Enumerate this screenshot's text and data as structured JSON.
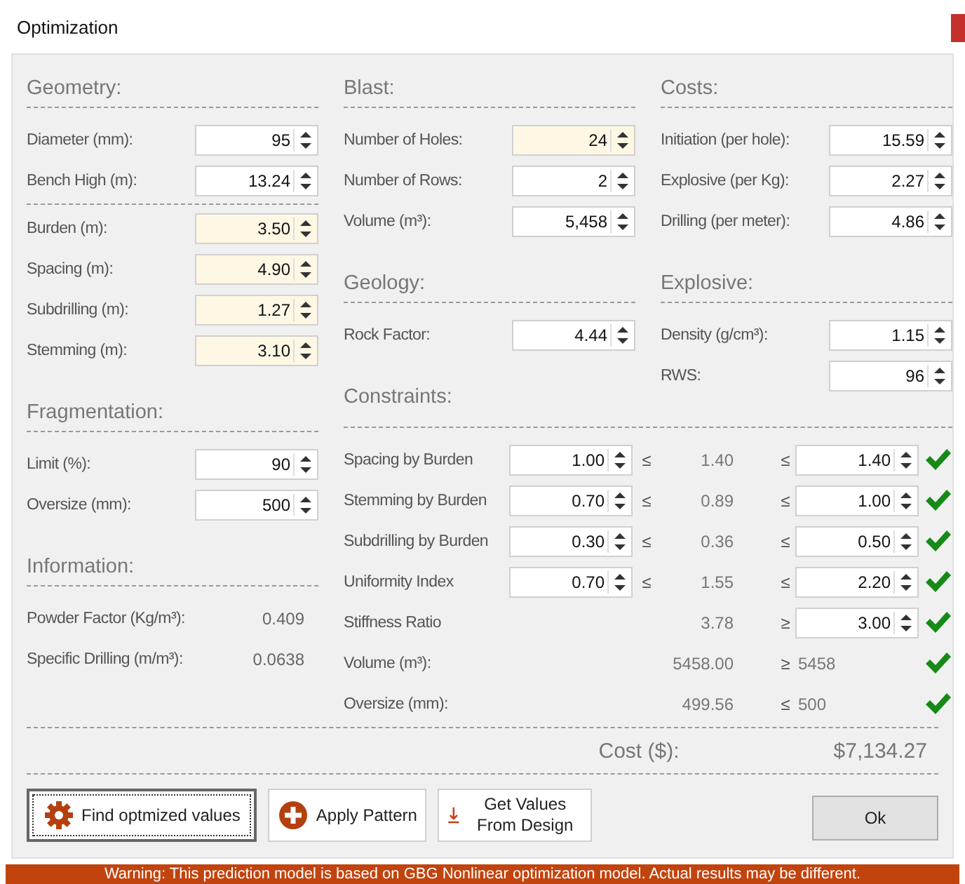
{
  "window": {
    "title": "Optimization"
  },
  "geometry": {
    "title": "Geometry:",
    "groups": [
      [
        {
          "label": "Diameter (mm):",
          "value": "95",
          "highlighted": false
        },
        {
          "label": "Bench High (m):",
          "value": "13.24",
          "highlighted": false
        }
      ],
      [
        {
          "label": "Burden (m):",
          "value": "3.50",
          "highlighted": true
        },
        {
          "label": "Spacing  (m):",
          "value": "4.90",
          "highlighted": true
        },
        {
          "label": "Subdrilling (m):",
          "value": "1.27",
          "highlighted": true
        },
        {
          "label": "Stemming (m):",
          "value": "3.10",
          "highlighted": true
        }
      ]
    ]
  },
  "fragmentation": {
    "title": "Fragmentation:",
    "fields": [
      {
        "label": "Limit (%):",
        "value": "90",
        "highlighted": false
      },
      {
        "label": "Oversize (mm):",
        "value": "500",
        "highlighted": false
      }
    ]
  },
  "information": {
    "title": "Information:",
    "rows": [
      {
        "label": "Powder Factor (Kg/m³):",
        "value": "0.409"
      },
      {
        "label": "Specific Drilling (m/m³):",
        "value": "0.0638"
      }
    ]
  },
  "blast": {
    "title": "Blast:",
    "fields": [
      {
        "label": "Number of Holes:",
        "value": "24",
        "highlighted": true
      },
      {
        "label": "Number of Rows:",
        "value": "2",
        "highlighted": false
      },
      {
        "label": "Volume (m³):",
        "value": "5,458",
        "highlighted": false
      }
    ]
  },
  "geology": {
    "title": "Geology:",
    "fields": [
      {
        "label": "Rock Factor:",
        "value": "4.44",
        "highlighted": false
      }
    ]
  },
  "costs": {
    "title": "Costs:",
    "fields": [
      {
        "label": "Initiation (per hole):",
        "value": "15.59",
        "highlighted": false
      },
      {
        "label": "Explosive (per Kg):",
        "value": "2.27",
        "highlighted": false
      },
      {
        "label": "Drilling (per meter):",
        "value": "4.86",
        "highlighted": false
      }
    ]
  },
  "explosive": {
    "title": "Explosive:",
    "fields": [
      {
        "label": "Density (g/cm³):",
        "value": "1.15",
        "highlighted": false
      },
      {
        "label": "RWS:",
        "value": "96",
        "highlighted": false
      }
    ]
  },
  "constraints": {
    "title": "Constraints:",
    "rows": [
      {
        "kind": "range",
        "label": "Spacing by Burden",
        "min": "1.00",
        "relation_min": "≤",
        "value": "1.40",
        "relation": "≤",
        "max": "1.40",
        "met": true
      },
      {
        "kind": "range",
        "label": "Stemming by Burden",
        "min": "0.70",
        "relation_min": "≤",
        "value": "0.89",
        "relation": "≤",
        "max": "1.00",
        "met": true
      },
      {
        "kind": "range",
        "label": "Subdrilling by Burden",
        "min": "0.30",
        "relation_min": "≤",
        "value": "0.36",
        "relation": "≤",
        "max": "0.50",
        "met": true
      },
      {
        "kind": "range",
        "label": "Uniformity Index",
        "min": "0.70",
        "relation_min": "≤",
        "value": "1.55",
        "relation": "≤",
        "max": "2.20",
        "met": true
      },
      {
        "kind": "bound",
        "label": "Stiffness Ratio",
        "value": "3.78",
        "relation": "≥",
        "max": "3.00",
        "met": true
      },
      {
        "kind": "limit",
        "label": "Volume (m³):",
        "value": "5458.00",
        "relation": "≥",
        "limit": "5458",
        "met": true
      },
      {
        "kind": "limit",
        "label": "Oversize (mm):",
        "value": "499.56",
        "relation": "≤",
        "limit": "500",
        "met": true
      }
    ]
  },
  "cost": {
    "label": "Cost ($):",
    "value": "$7,134.27"
  },
  "buttons": [
    {
      "kind": "gear",
      "label": "Find optmized values",
      "focused": true
    },
    {
      "kind": "plus",
      "label": "Apply Pattern",
      "focused": false
    },
    {
      "kind": "download",
      "label": "Get Values From Design",
      "focused": false
    },
    {
      "kind": "plain",
      "label": "Ok",
      "focused": false
    }
  ],
  "warning": "Warning: This prediction model is based on GBG Nonlinear optimization model. Actual results may be different."
}
